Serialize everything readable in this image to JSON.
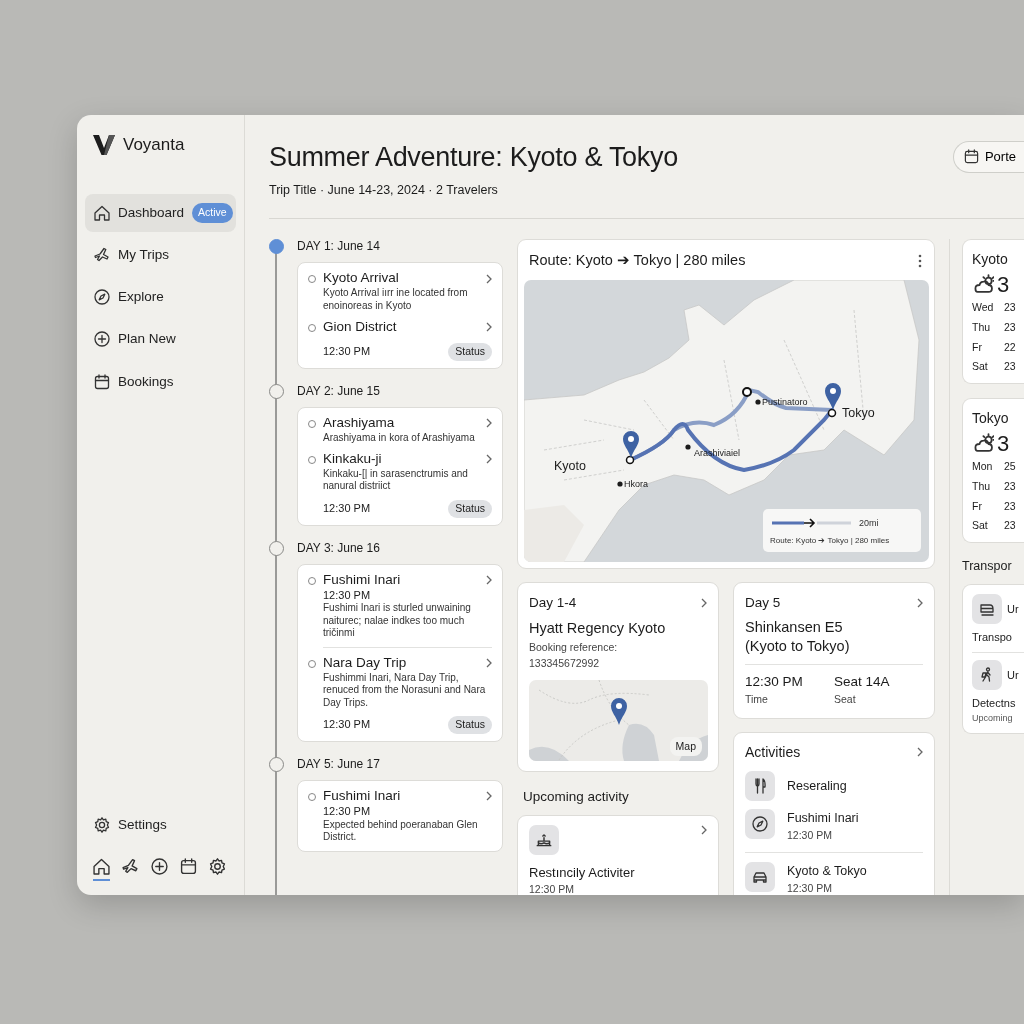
{
  "brand": {
    "name": "Voyanta"
  },
  "sidebar": {
    "items": [
      {
        "label": "Dashboard",
        "badge": "Active",
        "selected": true
      },
      {
        "label": "My Trips",
        "selected": false
      },
      {
        "label": "Explore",
        "selected": false
      },
      {
        "label": "Plan New",
        "selected": false
      },
      {
        "label": "Bookings",
        "selected": false
      }
    ],
    "settings": {
      "label": "Settings"
    },
    "bottom_bar": [
      {
        "selected": true
      },
      {
        "selected": false
      },
      {
        "selected": false
      },
      {
        "selected": false
      },
      {
        "selected": false
      }
    ]
  },
  "header": {
    "title": "Summer Adventure: Kyoto & Tokyo",
    "subtitle": "Trip Title · June 14-23, 2024 · 2 Travelers",
    "action": "Porte"
  },
  "timeline": [
    {
      "label": "DAY 1: June 14",
      "current": true,
      "stops": [
        {
          "title": "Kyoto Arrival",
          "description": "Kyoto Arrival iırr ine located from enoinoreas in Kyoto"
        },
        {
          "title": "Gion District"
        }
      ],
      "time": "12:30 PM",
      "status": "Status"
    },
    {
      "label": "DAY 2: June 15",
      "current": false,
      "stops": [
        {
          "title": "Arashiyama",
          "description": "Arashiyama in kora of Arashiyama"
        },
        {
          "title": "Kinkaku-ji",
          "description": "Kinkaku-[| in sarasenctrumis and nanural distriict"
        }
      ],
      "time": "12:30 PM",
      "status": "Status"
    },
    {
      "label": "DAY 3: June 16",
      "current": false,
      "stops": [
        {
          "title": "Fushimi Inari",
          "time": "12:30 PM",
          "description": "Fushimi Inari is sturled unwaining naiturec; nalae indkes too much tričinmi"
        },
        {
          "title": "Nara Day Trip",
          "description": "Fushimmi Inari, Nara Day Trip, renuced from the Norasuni and Nara Day Trips."
        }
      ],
      "time": "12:30 PM",
      "status": "Status"
    },
    {
      "label": "DAY 5: June 17",
      "current": false,
      "stops": [
        {
          "title": "Fushimi Inari",
          "time": "12:30 PM",
          "description": "Expected behind poeranaban Glen District."
        }
      ]
    }
  ],
  "route": {
    "title": "Route: Kyoto ➔ Tokyo | 280 miles",
    "labels": [
      {
        "text": "Kyoto",
        "kind": "city"
      },
      {
        "text": "Tokyo",
        "kind": "city"
      },
      {
        "text": "Hkora",
        "kind": "place"
      },
      {
        "text": "Arashiviaiel",
        "kind": "place"
      },
      {
        "text": "Pustinatoro",
        "kind": "place"
      }
    ],
    "legend_distance": "20mi",
    "legend_text": "Route: Kyoto ➔ Tokyo | 280 miles"
  },
  "hotel": {
    "day": "Day 1-4",
    "name": "Hyatt Regency Kyoto",
    "reference_label": "Booking reference:",
    "reference": "133345672992",
    "map_label": "Map"
  },
  "train": {
    "day": "Day 5",
    "name": "Shinkansen E5 (Kyoto to Tokyo)",
    "fields": [
      {
        "value": "12:30 PM",
        "label": "Time"
      },
      {
        "value": "Seat 14A",
        "label": "Seat"
      }
    ]
  },
  "upcoming": {
    "heading": "Upcoming activity",
    "title": "Restıncily Activiter",
    "time": "12:30 PM"
  },
  "activities": {
    "title": "Activities",
    "items": [
      {
        "name": "Reseraling"
      },
      {
        "name": "Fushimi Inari",
        "time": "12:30 PM"
      },
      {
        "name": "Kyoto & Tokyo",
        "time": "12:30 PM"
      }
    ]
  },
  "weather": [
    {
      "city": "Kyoto",
      "temp": "3",
      "days": [
        {
          "day": "Wed",
          "temp": "23"
        },
        {
          "day": "Thu",
          "temp": "23"
        },
        {
          "day": "Fr",
          "temp": "22"
        },
        {
          "day": "Sat",
          "temp": "23"
        }
      ]
    },
    {
      "city": "Tokyo",
      "temp": "3",
      "days": [
        {
          "day": "Mon",
          "temp": "25"
        },
        {
          "day": "Thu",
          "temp": "23"
        },
        {
          "day": "Fr",
          "temp": "23"
        },
        {
          "day": "Sat",
          "temp": "23"
        }
      ]
    }
  ],
  "transport": {
    "heading": "Transpor",
    "items": [
      {
        "label": "Ur",
        "title": "Transpo"
      },
      {
        "label": "Ur",
        "title": "Detectns",
        "subtitle": "Upcoming"
      }
    ]
  }
}
